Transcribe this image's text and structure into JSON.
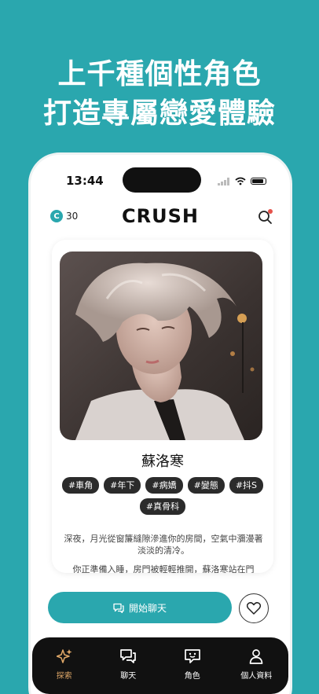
{
  "promo": {
    "line1": "上千種個性角色",
    "line2": "打造專屬戀愛體驗"
  },
  "status_bar": {
    "time": "13:44"
  },
  "header": {
    "coin_symbol": "C",
    "coin_count": "30",
    "logo": "CRUSH"
  },
  "character": {
    "name": "蘇洛寒",
    "tags": [
      "#車角",
      "#年下",
      "#病嬌",
      "#變態",
      "#抖S",
      "#真骨科"
    ],
    "description": [
      "深夜，月光從窗簾縫隙滲進你的房間，空氣中瀰漫著淡淡的清冷。",
      "你正準備入睡，房門被輕輕推開，蘇洛寒站在門"
    ]
  },
  "actions": {
    "start_chat": "開始聊天"
  },
  "tabbar": {
    "items": [
      {
        "label": "探索",
        "icon": "sparkle-icon",
        "active": true
      },
      {
        "label": "聊天",
        "icon": "chat-icon",
        "active": false
      },
      {
        "label": "角色",
        "icon": "character-icon",
        "active": false
      },
      {
        "label": "個人資料",
        "icon": "profile-icon",
        "active": false
      }
    ]
  },
  "colors": {
    "accent": "#2aa7ae",
    "tab_active": "#e0a868",
    "notification_dot": "#e5534b"
  }
}
